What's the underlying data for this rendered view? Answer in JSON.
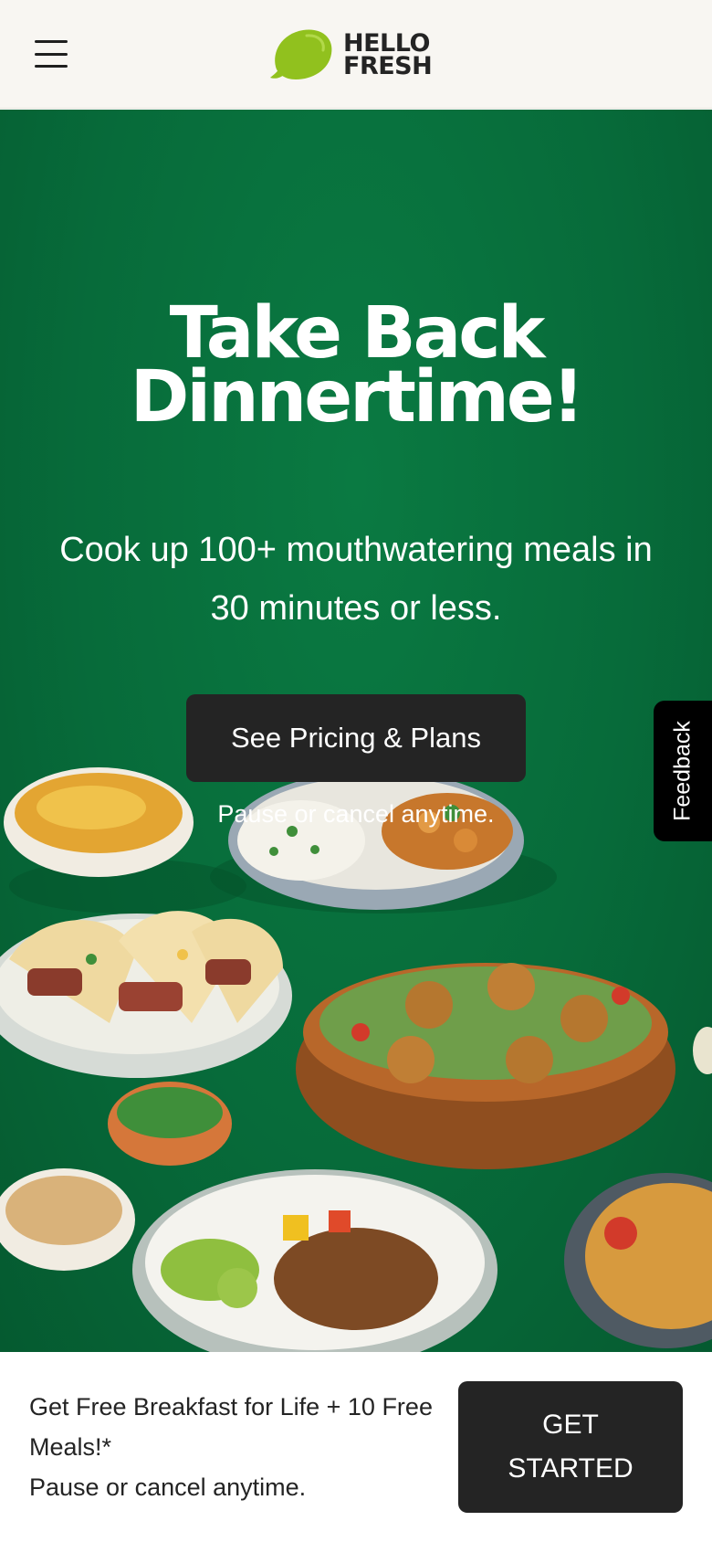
{
  "header": {
    "menu_icon": "hamburger-menu-icon",
    "logo_icon": "lime-icon",
    "logo_line1": "HELLO",
    "logo_line2": "FRESH"
  },
  "hero": {
    "title_line1": "Take Back",
    "title_line2": "Dinnertime!",
    "subtitle": "Cook up 100+ mouthwatering meals in 30 minutes or less.",
    "cta_label": "See Pricing & Plans",
    "pause_text": "Pause or cancel anytime.",
    "background_color": "#076b3a"
  },
  "feedback": {
    "label": "Feedback"
  },
  "bottom_bar": {
    "promo_line1": "Get Free Breakfast for Life + 10 Free Meals!*",
    "promo_line2": "Pause or cancel anytime.",
    "button_label": "GET STARTED"
  },
  "colors": {
    "brand_green": "#076b3a",
    "lime": "#91c11e",
    "button_dark": "#242424"
  }
}
